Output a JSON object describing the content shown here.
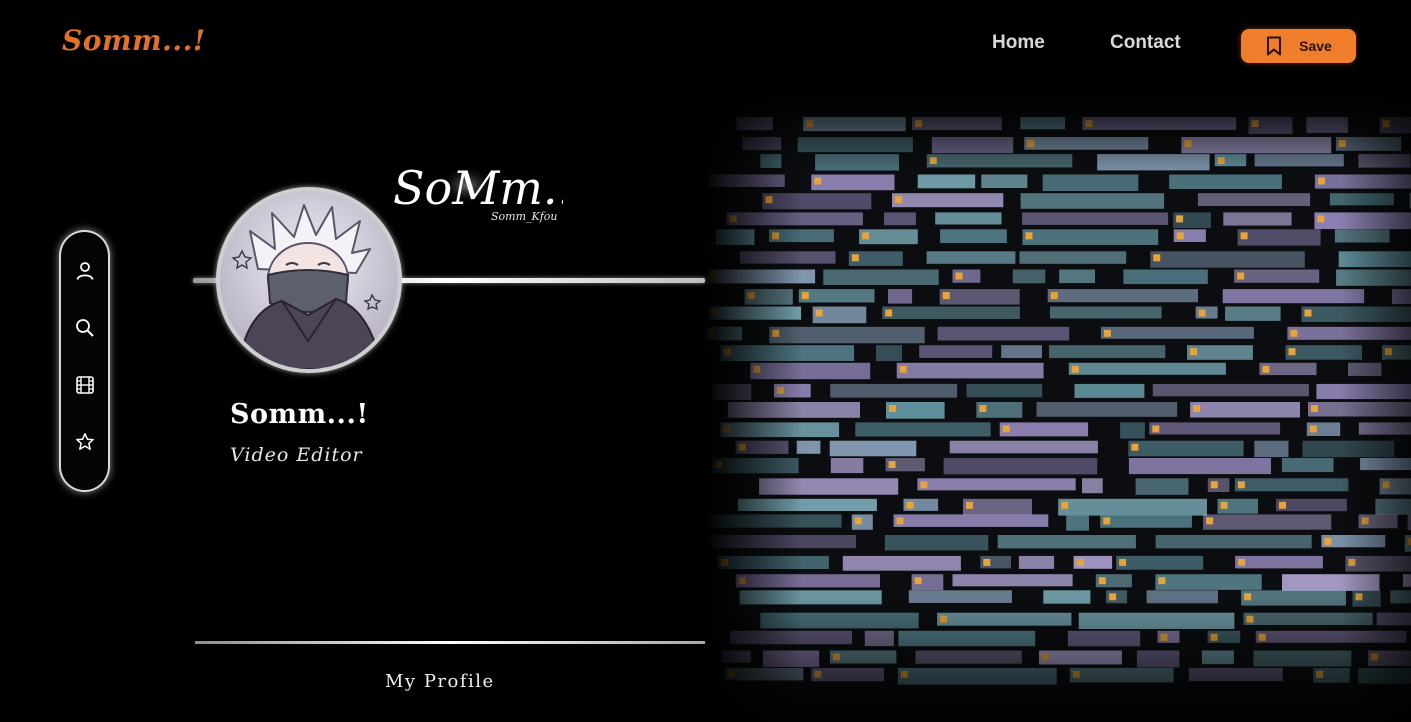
{
  "brand": {
    "logo_text": "Somm...!",
    "accent_color": "#f07d2c"
  },
  "nav": {
    "home_label": "Home",
    "contact_label": "Contact",
    "save_label": "Save"
  },
  "sidebar": {
    "items": [
      {
        "icon": "user-icon"
      },
      {
        "icon": "search-icon"
      },
      {
        "icon": "film-icon"
      },
      {
        "icon": "star-icon"
      }
    ]
  },
  "profile": {
    "signature_text": "SoMm...!",
    "signature_sub": "Somm_Kfou",
    "name": "Somm...!",
    "role": "Video Editor",
    "section_label": "My Profile"
  },
  "background_image": {
    "description_icon": "video-timeline-image"
  }
}
